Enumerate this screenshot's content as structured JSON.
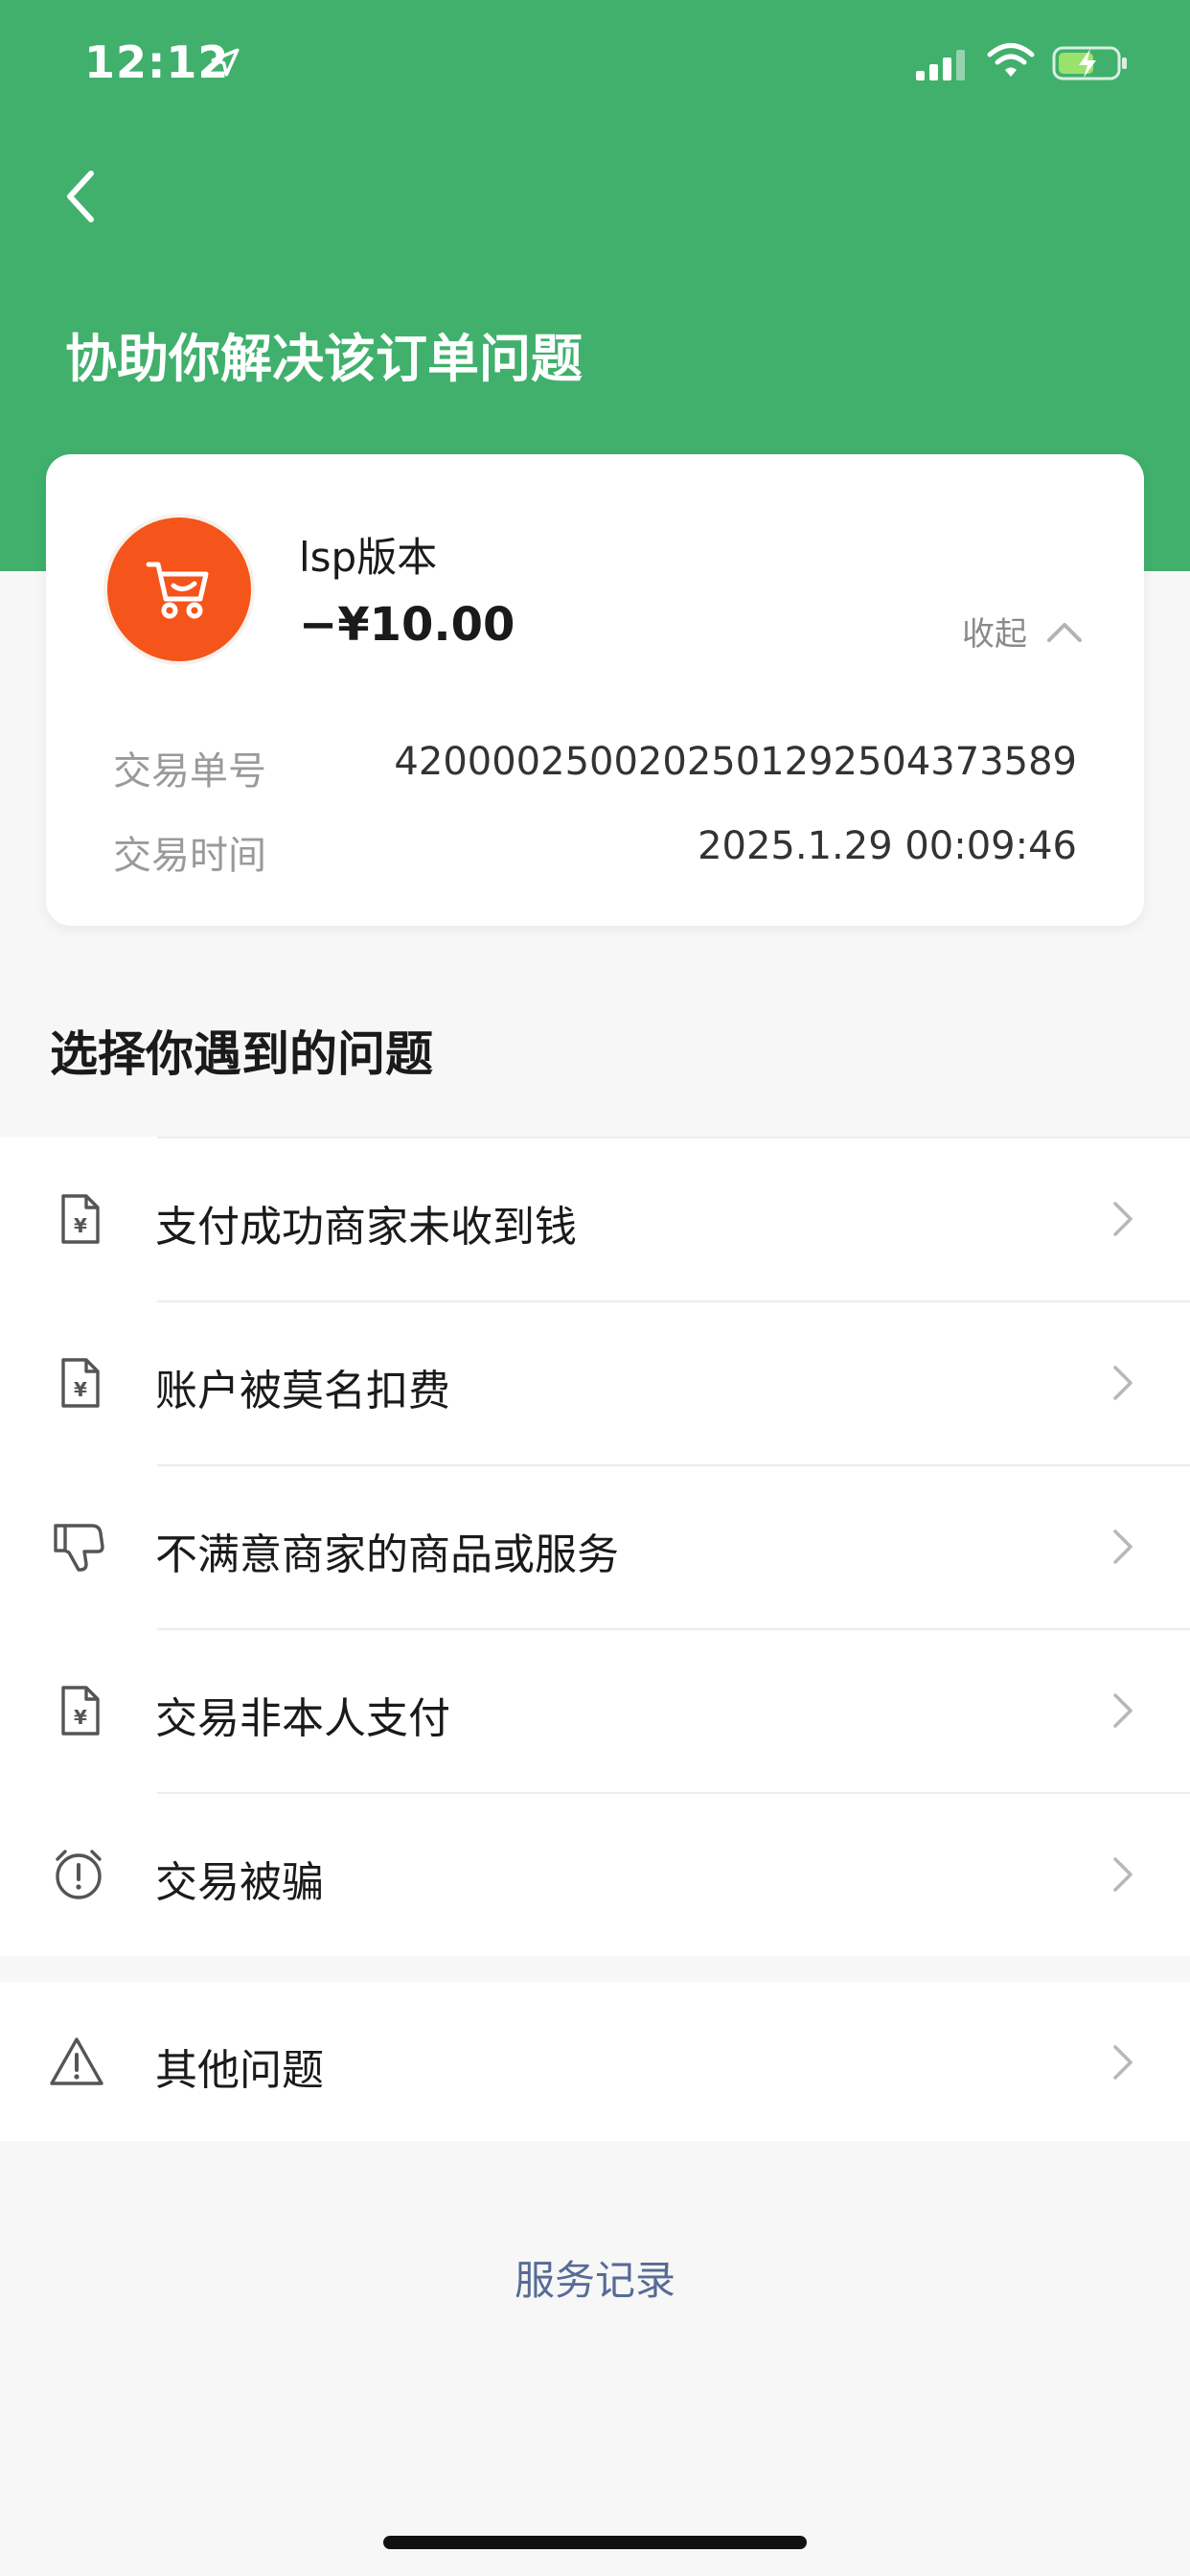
{
  "status": {
    "time": "12:12"
  },
  "header": {
    "title": "协助你解决该订单问题"
  },
  "order": {
    "merchant_name": "lsp版本",
    "amount": "−¥10.00",
    "collapse_label": "收起",
    "id_label": "交易单号",
    "id_value": "4200002500202501292504373589",
    "time_label": "交易时间",
    "time_value": "2025.1.29 00:09:46",
    "logo_color": "#f5541a"
  },
  "section": {
    "title": "选择你遇到的问题"
  },
  "issues": [
    {
      "label": "支付成功商家未收到钱",
      "icon": "receipt-yuan-icon"
    },
    {
      "label": "账户被莫名扣费",
      "icon": "receipt-yuan-icon"
    },
    {
      "label": "不满意商家的商品或服务",
      "icon": "thumbs-down-icon"
    },
    {
      "label": "交易非本人支付",
      "icon": "receipt-yuan-icon"
    },
    {
      "label": "交易被骗",
      "icon": "alarm-alert-icon"
    }
  ],
  "other": {
    "label": "其他问题",
    "icon": "warning-triangle-icon"
  },
  "footer": {
    "service_record": "服务记录"
  },
  "colors": {
    "brand_green": "#40b06c",
    "link_blue": "#576b95"
  }
}
